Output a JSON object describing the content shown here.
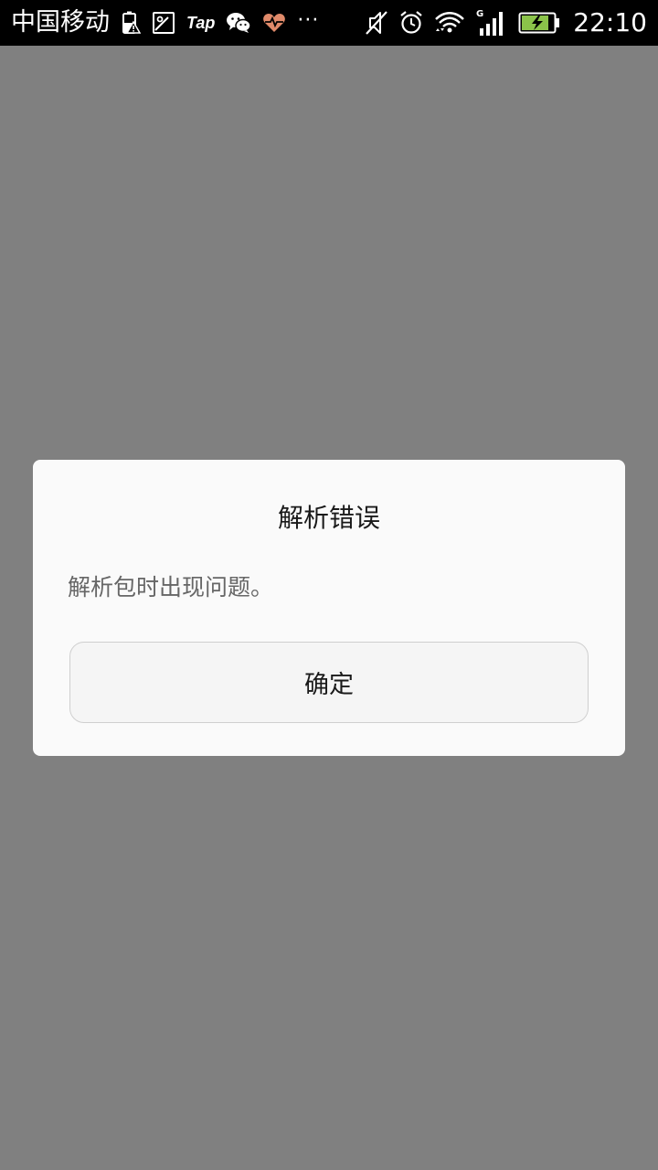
{
  "status_bar": {
    "carrier": "中国移动",
    "tap_label": "Tap",
    "more": "···",
    "network_type": "G",
    "time": "22:10",
    "colors": {
      "background": "#000000",
      "foreground": "#ffffff",
      "heart": "#e08a6a",
      "battery_fill": "#8bc34a"
    },
    "icons_left": [
      "battery-warning-icon",
      "image-icon",
      "tap-icon",
      "wechat-icon",
      "heart-rate-icon",
      "more-icon"
    ],
    "icons_right": [
      "silent-icon",
      "alarm-icon",
      "wifi-icon",
      "signal-icon",
      "battery-charging-icon"
    ]
  },
  "dialog": {
    "title": "解析错误",
    "message": "解析包时出现问题。",
    "ok_label": "确定",
    "colors": {
      "overlay": "#808080",
      "background": "#fafafa",
      "title": "#1a1a1a",
      "message": "#666666",
      "button_border": "#cfcfcf"
    }
  }
}
